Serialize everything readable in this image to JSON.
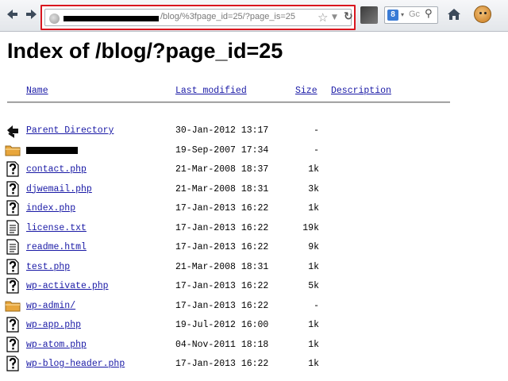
{
  "browser": {
    "url_visible_text": "/blog/%3fpage_id=25/?page_is=25",
    "search_placeholder": "Gc",
    "search_engine_letter": "8"
  },
  "page": {
    "title": "Index of /blog/?page_id=25"
  },
  "columns": {
    "name": "Name",
    "last_modified": "Last modified",
    "size": "Size",
    "description": "Description"
  },
  "rows": [
    {
      "name": "Parent Directory",
      "date": "30-Jan-2012 13:17",
      "size": "-",
      "icon": "back-arrow-icon"
    },
    {
      "name": "",
      "date": "19-Sep-2007 17:34",
      "size": "-",
      "icon": "folder-icon",
      "redacted": true
    },
    {
      "name": "contact.php",
      "date": "21-Mar-2008 18:37",
      "size": "1k",
      "icon": "unknown-file-icon"
    },
    {
      "name": "djwemail.php",
      "date": "21-Mar-2008 18:31",
      "size": "3k",
      "icon": "unknown-file-icon"
    },
    {
      "name": "index.php",
      "date": "17-Jan-2013 16:22",
      "size": "1k",
      "icon": "unknown-file-icon"
    },
    {
      "name": "license.txt",
      "date": "17-Jan-2013 16:22",
      "size": "19k",
      "icon": "text-file-icon"
    },
    {
      "name": "readme.html",
      "date": "17-Jan-2013 16:22",
      "size": "9k",
      "icon": "text-file-icon"
    },
    {
      "name": "test.php",
      "date": "21-Mar-2008 18:31",
      "size": "1k",
      "icon": "unknown-file-icon"
    },
    {
      "name": "wp-activate.php",
      "date": "17-Jan-2013 16:22",
      "size": "5k",
      "icon": "unknown-file-icon"
    },
    {
      "name": "wp-admin/",
      "date": "17-Jan-2013 16:22",
      "size": "-",
      "icon": "folder-icon"
    },
    {
      "name": "wp-app.php",
      "date": "19-Jul-2012 16:00",
      "size": "1k",
      "icon": "unknown-file-icon"
    },
    {
      "name": "wp-atom.php",
      "date": "04-Nov-2011 18:18",
      "size": "1k",
      "icon": "unknown-file-icon"
    },
    {
      "name": "wp-blog-header.php",
      "date": "17-Jan-2013 16:22",
      "size": "1k",
      "icon": "unknown-file-icon"
    }
  ]
}
